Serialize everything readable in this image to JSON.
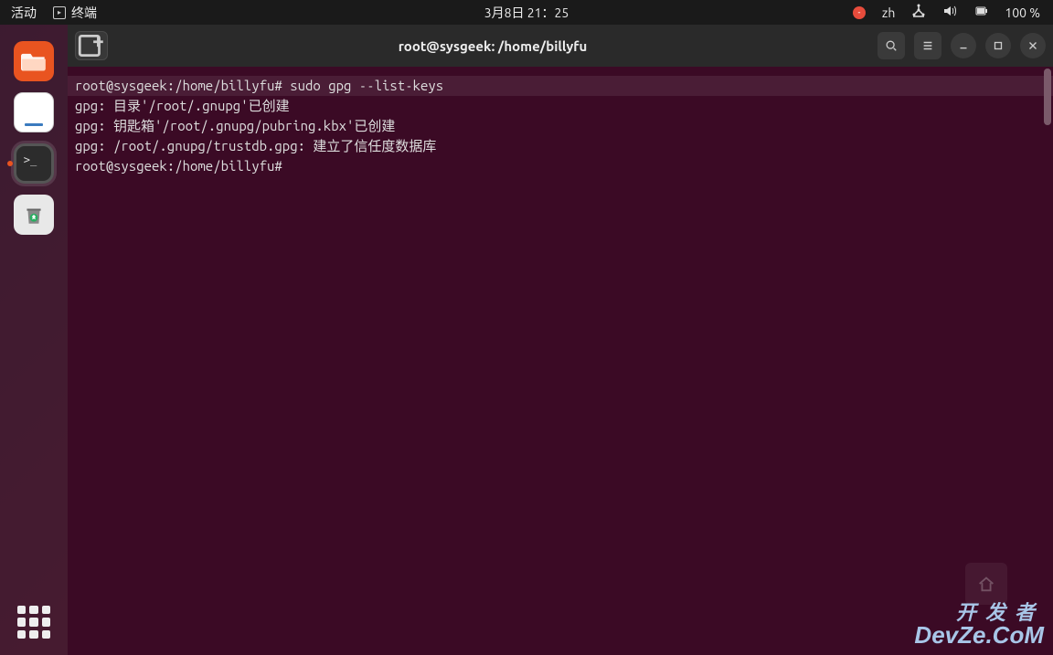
{
  "topbar": {
    "activities": "活动",
    "app_label": "终端",
    "datetime": "3月8日 21：25",
    "input_method": "zh",
    "battery": "100 %"
  },
  "window": {
    "title": "root@sysgeek: /home/billyfu"
  },
  "terminal": {
    "lines": [
      "root@sysgeek:/home/billyfu# sudo gpg --list-keys",
      "gpg: 目录'/root/.gnupg'已创建",
      "gpg: 钥匙箱'/root/.gnupg/pubring.kbx'已创建",
      "gpg: /root/.gnupg/trustdb.gpg: 建立了信任度数据库",
      "root@sysgeek:/home/billyfu# "
    ]
  },
  "watermark": {
    "line1": "开发者",
    "line2": "DevZe.CoM"
  }
}
